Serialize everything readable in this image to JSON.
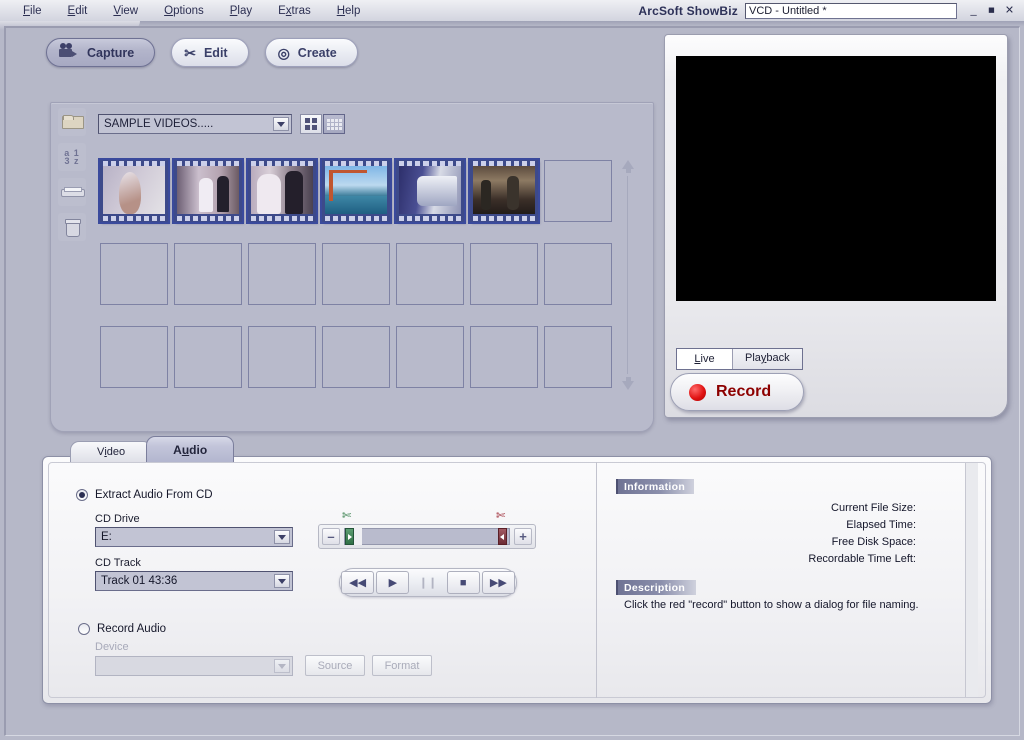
{
  "window": {
    "app_title": "ArcSoft ShowBiz",
    "document_title": "VCD - Untitled *",
    "minimize": "_",
    "maximize": "■",
    "close": "✕"
  },
  "menubar": {
    "items": [
      {
        "label": "File"
      },
      {
        "label": "Edit"
      },
      {
        "label": "View"
      },
      {
        "label": "Options"
      },
      {
        "label": "Play"
      },
      {
        "label": "Extras"
      },
      {
        "label": "Help"
      }
    ]
  },
  "modes": {
    "tabs": [
      {
        "label": "Capture",
        "active": true
      },
      {
        "label": "Edit",
        "active": false
      },
      {
        "label": "Create",
        "active": false
      }
    ]
  },
  "album": {
    "selected_album": "SAMPLE VIDEOS.....",
    "side_icons": [
      "folder-icon",
      "sort-az-icon",
      "scanner-icon",
      "trash-icon"
    ],
    "view_modes": [
      {
        "name": "large-thumbnails",
        "selected": false
      },
      {
        "name": "small-thumbnails",
        "selected": true
      }
    ],
    "thumbnails": [
      {
        "name": "bride-portrait",
        "selected": true
      },
      {
        "name": "wedding-ceremony",
        "selected": true
      },
      {
        "name": "bride-and-groom",
        "selected": true
      },
      {
        "name": "golden-gate-bridge",
        "selected": true
      },
      {
        "name": "train-station",
        "selected": true
      },
      {
        "name": "street-crowd",
        "selected": true
      }
    ],
    "empty_slots": 15,
    "scroll_up": "▲",
    "scroll_down": "▼"
  },
  "preview": {
    "video_state": "black",
    "source_tabs": [
      {
        "label": "Live",
        "active": true
      },
      {
        "label": "Playback",
        "active": false
      }
    ],
    "record_label": "Record"
  },
  "capture_tabs": [
    {
      "label": "Video",
      "active": false
    },
    {
      "label": "Audio",
      "active": true
    }
  ],
  "audio_panel": {
    "extract": {
      "radio_label": "Extract Audio From CD",
      "selected": true,
      "cd_drive_label": "CD Drive",
      "cd_drive_value": "E:",
      "cd_track_label": "CD Track",
      "cd_track_value": "Track 01 43:36"
    },
    "record": {
      "radio_label": "Record Audio",
      "selected": false,
      "device_label": "Device",
      "device_value": "",
      "source_button": "Source",
      "format_button": "Format"
    },
    "trim": {
      "minus": "–",
      "plus": "+",
      "left_marker": "trim-start-marker",
      "right_marker": "trim-end-marker",
      "scissor_icon": "scissors-icon"
    },
    "transport": [
      {
        "name": "rewind-button",
        "glyph": "◀◀",
        "enabled": true
      },
      {
        "name": "play-button",
        "glyph": "▶",
        "enabled": true
      },
      {
        "name": "pause-button",
        "glyph": "❙❙",
        "enabled": false
      },
      {
        "name": "stop-button",
        "glyph": "■",
        "enabled": true
      },
      {
        "name": "forward-button",
        "glyph": "▶▶",
        "enabled": true
      }
    ]
  },
  "information": {
    "heading": "Information",
    "rows": [
      {
        "label": "Current File Size:",
        "value": ""
      },
      {
        "label": "Elapsed Time:",
        "value": ""
      },
      {
        "label": "Free Disk Space:",
        "value": ""
      },
      {
        "label": "Recordable Time Left:",
        "value": ""
      }
    ]
  },
  "description": {
    "heading": "Description",
    "text": "Click the red \"record\" button to show a dialog for file naming."
  }
}
